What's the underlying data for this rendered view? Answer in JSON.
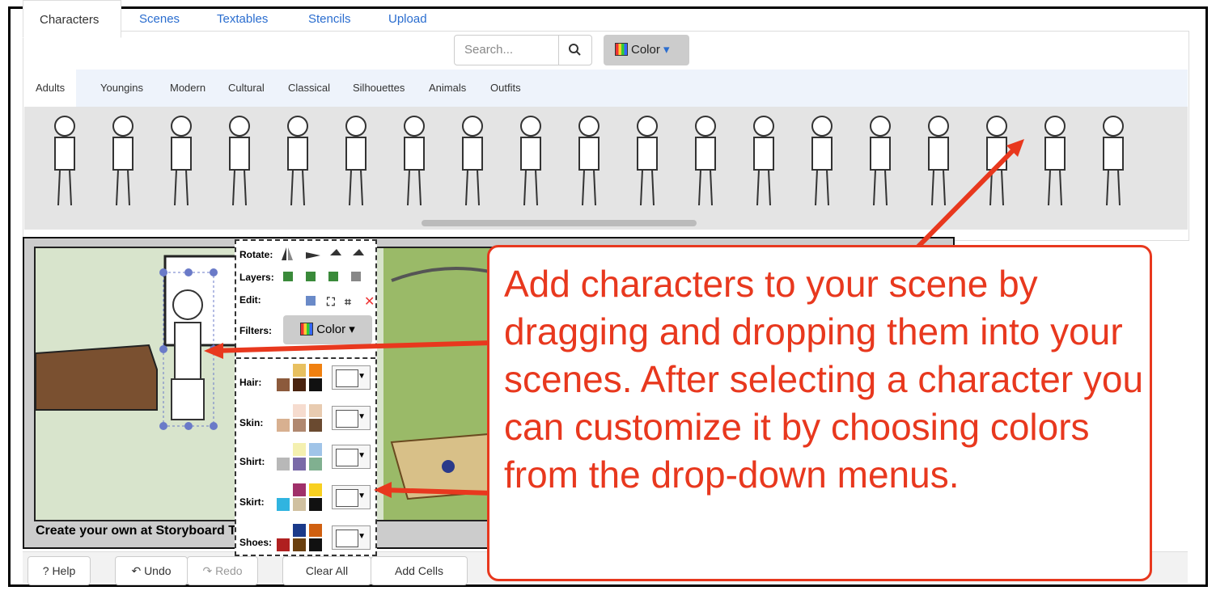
{
  "tabs": [
    "Characters",
    "Scenes",
    "Textables",
    "Stencils",
    "Upload"
  ],
  "search": {
    "placeholder": "Search..."
  },
  "color_button": "Color",
  "subtabs": [
    "Adults",
    "Youngins",
    "Modern",
    "Cultural",
    "Classical",
    "Silhouettes",
    "Animals",
    "Outfits"
  ],
  "popup": {
    "rotate": "Rotate:",
    "layers": "Layers:",
    "edit": "Edit:",
    "filters": "Filters:",
    "filters_button": "Color",
    "rows": [
      {
        "label": "Hair:",
        "colors": [
          "#ffffff",
          "#e8c060",
          "#f08010",
          "#8c5a3c",
          "#4a2410",
          "#111111"
        ]
      },
      {
        "label": "Skin:",
        "colors": [
          "#ffffff",
          "#f6dccf",
          "#e8cbb0",
          "#d8b090",
          "#b08870",
          "#6a4a30"
        ]
      },
      {
        "label": "Shirt:",
        "colors": [
          "#ffffff",
          "#f4f0b0",
          "#a0c4e8",
          "#b8b8b8",
          "#7a6aa8",
          "#80b090"
        ]
      },
      {
        "label": "Skirt:",
        "colors": [
          "#ffffff",
          "#a0306a",
          "#f8d020",
          "#30b4e0",
          "#d0c0a0",
          "#111111"
        ]
      },
      {
        "label": "Shoes:",
        "colors": [
          "#ffffff",
          "#1a3a8a",
          "#d06010",
          "#b02020",
          "#6a4010",
          "#111111"
        ]
      }
    ]
  },
  "footer": "Create your own at Storyboard That",
  "toolbar": {
    "help": "? Help",
    "undo": "↶ Undo",
    "redo": "↷ Redo",
    "clear": "Clear All",
    "add_cells": "Add Cells"
  },
  "callout": "Add characters to your scene by dragging and dropping them into your scenes. After selecting a character you can customize it by choosing colors from the drop-down menus."
}
